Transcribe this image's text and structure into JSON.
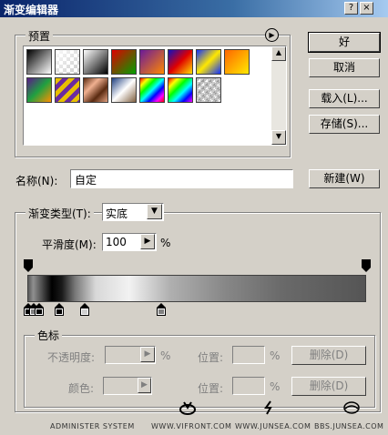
{
  "window": {
    "title": "渐变编辑器"
  },
  "titlebar_buttons": {
    "help": "?",
    "close": "×"
  },
  "presets": {
    "label": "预置",
    "menu_glyph": "▶"
  },
  "buttons": {
    "ok": "好",
    "cancel": "取消",
    "load": "载入(L)...",
    "save": "存储(S)...",
    "new": "新建(W)"
  },
  "name": {
    "label": "名称(N):",
    "value": "自定"
  },
  "gradient_type": {
    "label": "渐变类型(T):",
    "value": "实底"
  },
  "smoothness": {
    "label": "平滑度(M):",
    "value": "100",
    "unit": "%"
  },
  "color_stops": {
    "label": "色标",
    "opacity_label": "不透明度:",
    "opacity_unit": "%",
    "location_label": "位置:",
    "location_unit": "%",
    "delete_label": "删除(D)",
    "color_label": "颜色:",
    "color_location_label": "位置:",
    "color_location_unit": "%",
    "color_delete_label": "删除(D)"
  },
  "footer": {
    "left": "ADMINISTER SYSTEM",
    "mid1": "WWW.VIFRONT.COM",
    "mid2": "WWW.JUNSEA.COM",
    "right": "BBS.JUNSEA.COM"
  },
  "swatches": [
    {
      "icon": "black-white-gradient"
    },
    {
      "icon": "transparent-gradient"
    },
    {
      "icon": "black-white-gradient-2"
    },
    {
      "icon": "red-green-gradient"
    },
    {
      "icon": "violet-orange-gradient"
    },
    {
      "icon": "blue-red-yellow-gradient"
    },
    {
      "icon": "blue-yellow-blue-gradient"
    },
    {
      "icon": "orange-yellow-gradient"
    },
    {
      "icon": "violet-green-orange-gradient"
    },
    {
      "icon": "yellow-violet-stripes"
    },
    {
      "icon": "copper-gradient"
    },
    {
      "icon": "chrome-gradient"
    },
    {
      "icon": "spectrum-gradient"
    },
    {
      "icon": "transparent-rainbow-gradient"
    },
    {
      "icon": "transparent-stripes"
    }
  ],
  "colors": {
    "title_start": "#0a246a",
    "title_end": "#a6caf0",
    "face": "#d4d0c8"
  }
}
